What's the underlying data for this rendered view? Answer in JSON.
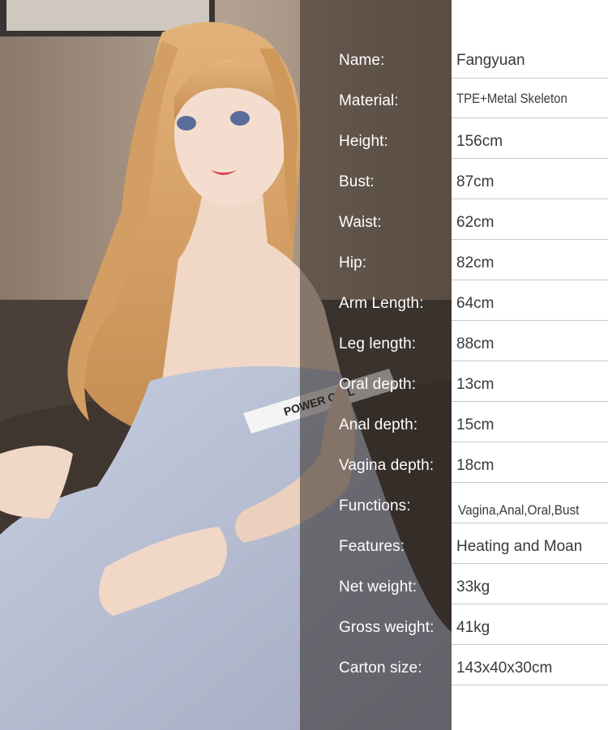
{
  "specs": [
    {
      "label": "Name:",
      "value": "Fangyuan"
    },
    {
      "label": "Material:",
      "value": "TPE+Metal Skeleton"
    },
    {
      "label": "Height:",
      "value": "156cm"
    },
    {
      "label": "Bust:",
      "value": "87cm"
    },
    {
      "label": "Waist:",
      "value": "62cm"
    },
    {
      "label": "Hip:",
      "value": "82cm"
    },
    {
      "label": "Arm Length:",
      "value": "64cm"
    },
    {
      "label": "Leg length:",
      "value": "88cm"
    },
    {
      "label": "Oral depth:",
      "value": "13cm"
    },
    {
      "label": "Anal depth:",
      "value": "15cm"
    },
    {
      "label": "Vagina depth:",
      "value": "18cm"
    },
    {
      "label": "Functions:",
      "value": "Vagina,Anal,Oral,Bust"
    },
    {
      "label": "Features:",
      "value": "Heating and Moan"
    },
    {
      "label": "Net weight:",
      "value": "33kg"
    },
    {
      "label": "Gross weight:",
      "value": "41kg"
    },
    {
      "label": "Carton size:",
      "value": "143x40x30cm"
    }
  ],
  "photo": {
    "shirt_print": "POWER GIRL"
  },
  "colors": {
    "label_text": "#ffffff",
    "value_text": "#3a3a3a",
    "divider": "#c8c8c8",
    "hair": "#d9a56a",
    "dress": "#b7bfd3",
    "sofa": "#4a4039"
  }
}
